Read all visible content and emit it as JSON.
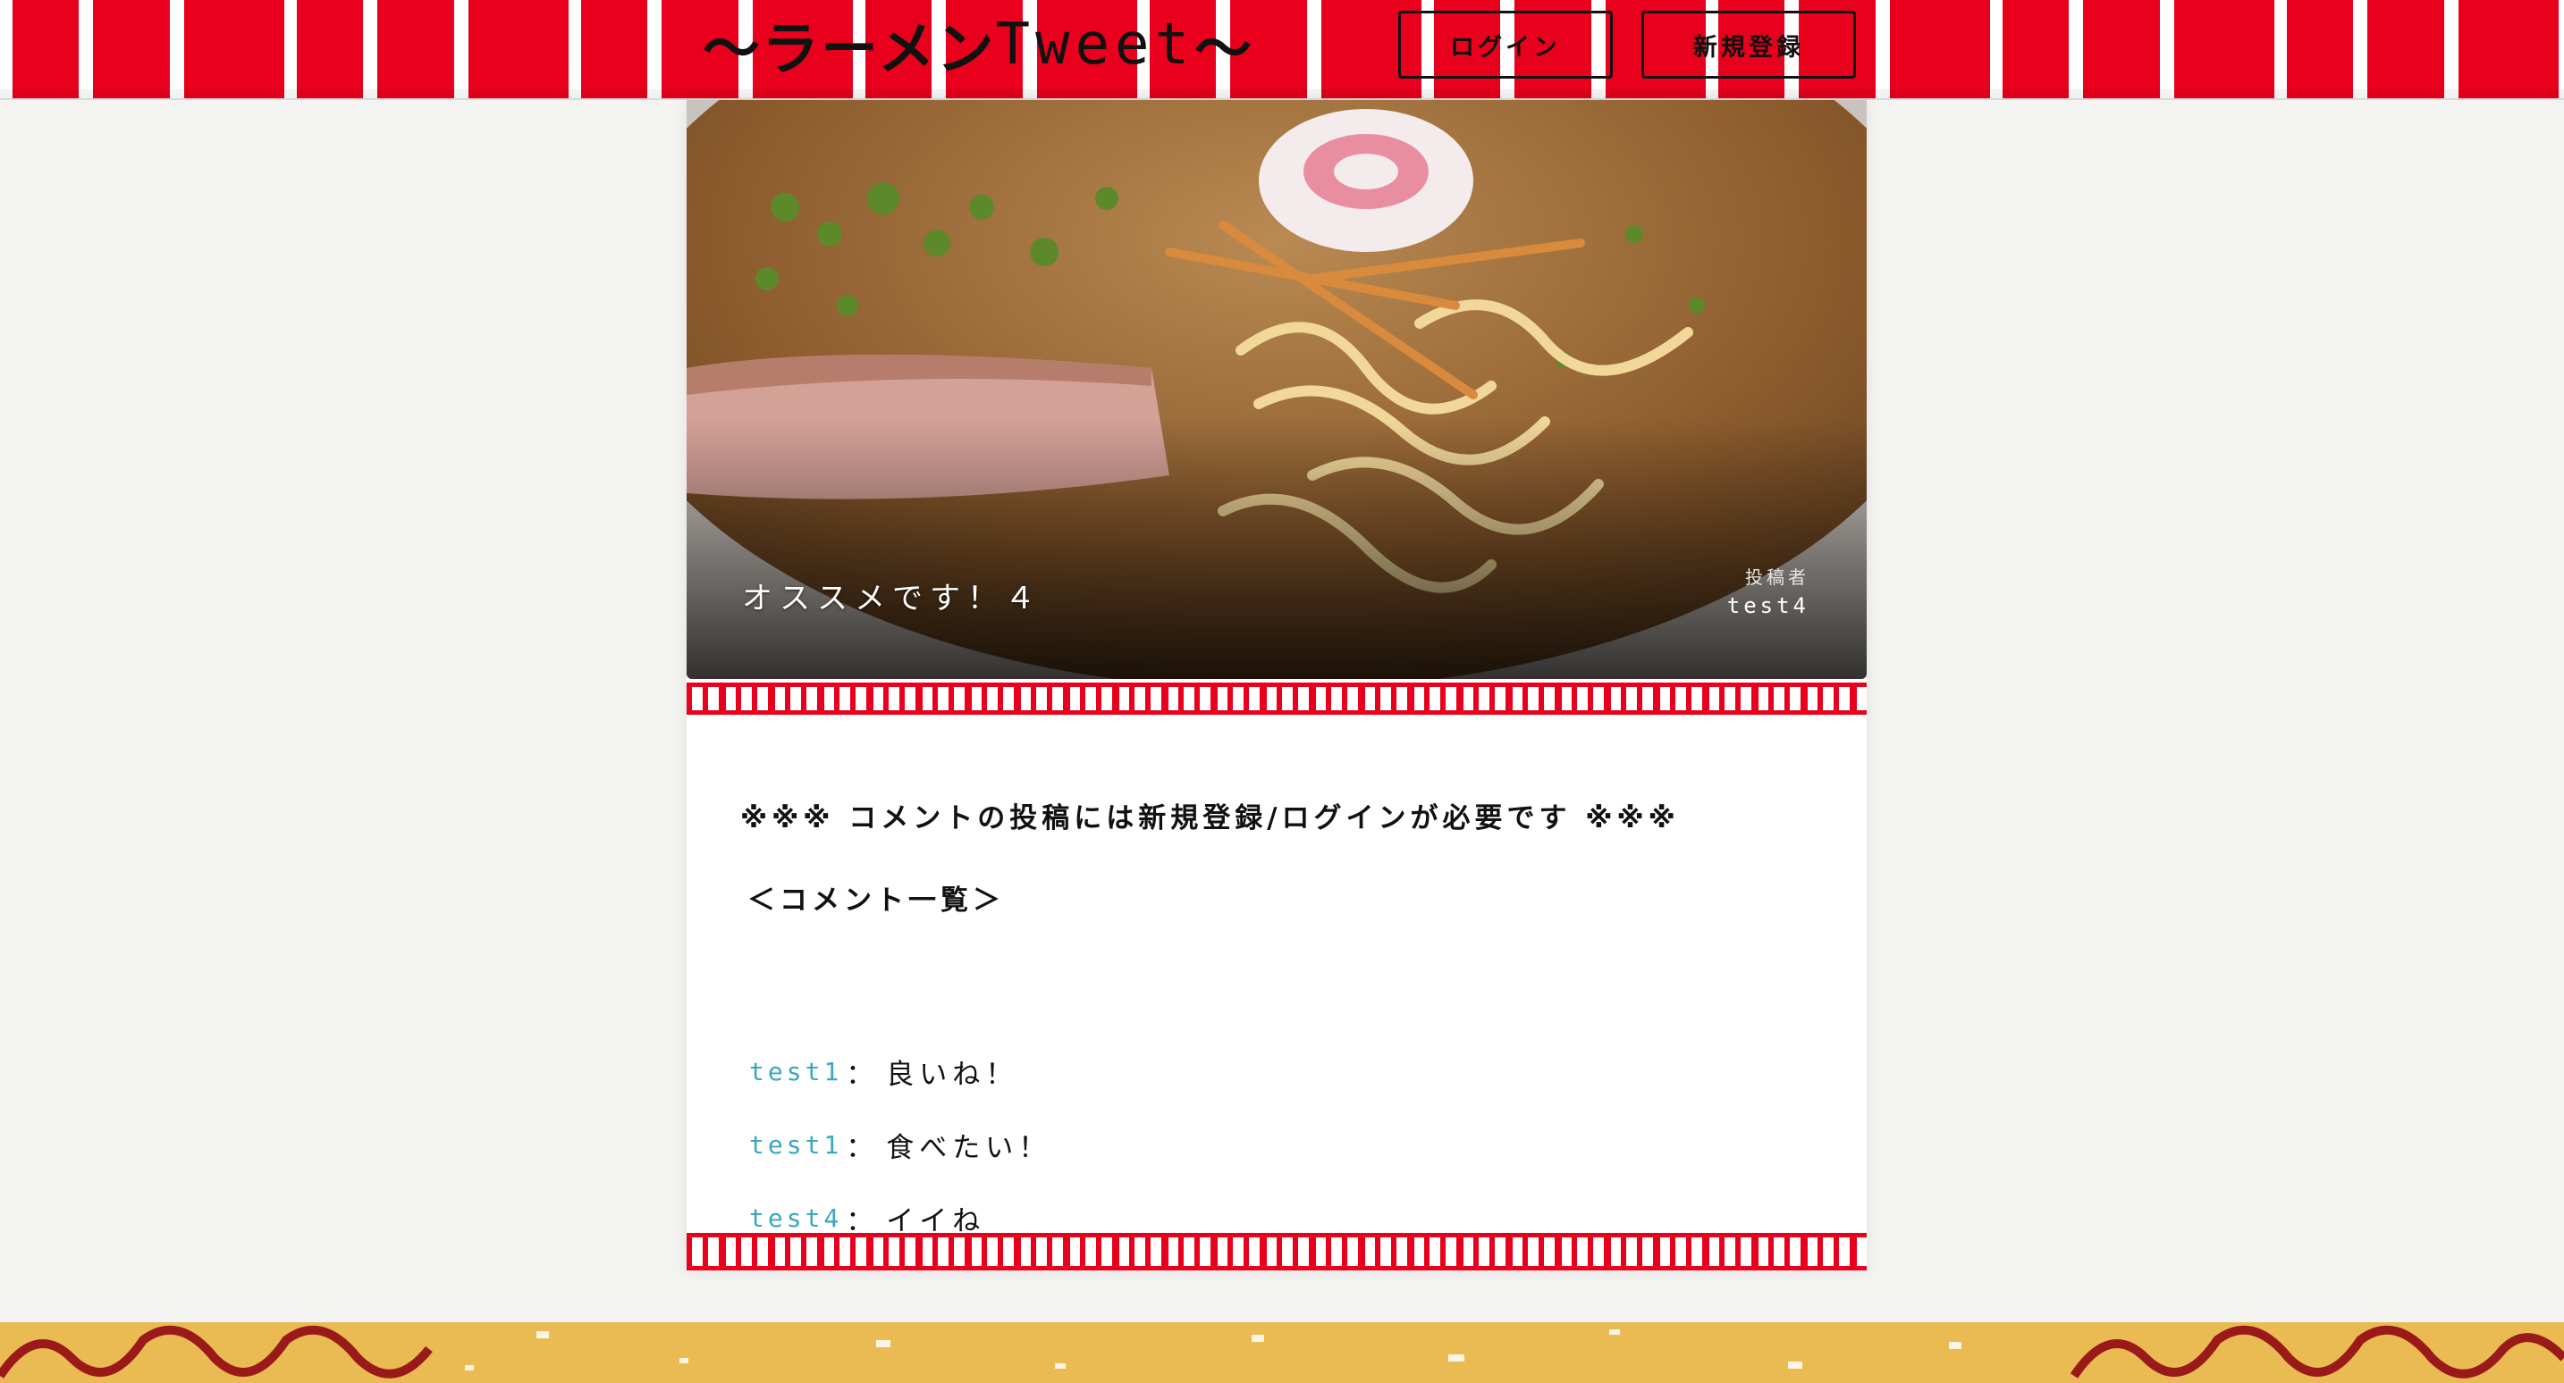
{
  "header": {
    "logo_text": "〜ラーメン",
    "logo_tweet": "Tweet",
    "logo_tail": "〜",
    "login_label": "ログイン",
    "signup_label": "新規登録"
  },
  "post": {
    "title": "オススメです！４",
    "author_label": "投稿者",
    "author_name": "test4"
  },
  "notice": "※※※ コメントの投稿には新規登録/ログインが必要です ※※※",
  "comments_heading": "＜コメント一覧＞",
  "comments": [
    {
      "user": "test1",
      "separator": "：",
      "text": "良いね！"
    },
    {
      "user": "test1",
      "separator": "：",
      "text": "食べたい！"
    },
    {
      "user": "test4",
      "separator": "：",
      "text": "イイね"
    }
  ],
  "colors": {
    "curtain_red": "#e8001c",
    "username_blue": "#3aa7bf",
    "footer_gold": "#e9bb52"
  }
}
